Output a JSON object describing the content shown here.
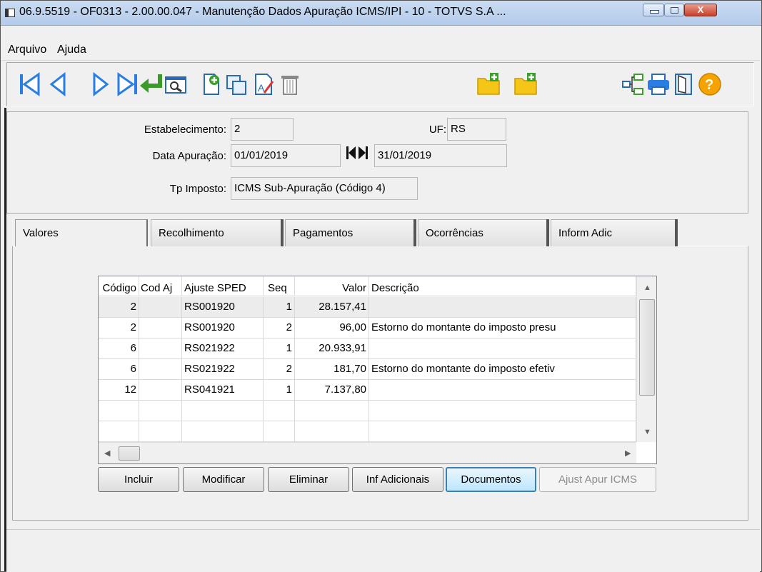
{
  "window": {
    "title": "06.9.5519 - OF0313 - 2.00.00.047 - Manutenção Dados Apuração ICMS/IPI - 10 - TOTVS S.A ...",
    "close_glyph": "X"
  },
  "menu": {
    "items": [
      "Arquivo",
      "Ajuda"
    ]
  },
  "toolbar": {
    "icons": [
      "first-record",
      "previous-record",
      "next-record",
      "last-record",
      "return",
      "search",
      "new-document",
      "copy",
      "edit",
      "delete",
      "folder-add",
      "folder-add-2",
      "tree",
      "print",
      "exit",
      "help"
    ],
    "help_glyph": "?"
  },
  "header": {
    "estabelecimento_label": "Estabelecimento:",
    "estabelecimento_value": "2",
    "uf_label": "UF:",
    "uf_value": "RS",
    "data_label": "Data Apuração:",
    "data_inicio": "01/01/2019",
    "data_fim": "31/01/2019",
    "tp_label": "Tp Imposto:",
    "tp_value": "ICMS Sub-Apuração (Código 4)"
  },
  "tabs": [
    "Valores",
    "Recolhimento",
    "Pagamentos",
    "Ocorrências",
    "Inform Adic"
  ],
  "grid": {
    "columns": [
      "Código",
      "Cod Aj",
      "Ajuste SPED",
      "Seq",
      "Valor",
      "Descrição"
    ],
    "rows": [
      [
        "2",
        "",
        "RS001920",
        "1",
        "28.157,41",
        ""
      ],
      [
        "2",
        "",
        "RS001920",
        "2",
        "96,00",
        "Estorno do montante do imposto presu"
      ],
      [
        "6",
        "",
        "RS021922",
        "1",
        "20.933,91",
        ""
      ],
      [
        "6",
        "",
        "RS021922",
        "2",
        "181,70",
        "Estorno do montante do imposto efetiv"
      ],
      [
        "12",
        "",
        "RS041921",
        "1",
        "7.137,80",
        ""
      ],
      [
        "",
        "",
        "",
        "",
        "",
        ""
      ],
      [
        "",
        "",
        "",
        "",
        "",
        ""
      ]
    ]
  },
  "buttons": {
    "incluir": "Incluir",
    "modificar": "Modificar",
    "eliminar": "Eliminar",
    "inf_adicionais": "Inf Adicionais",
    "documentos": "Documentos",
    "ajust_apur": "Ajust Apur ICMS"
  },
  "colors": {
    "accent": "#3c7fb1",
    "title_bar": "#b4cbea",
    "nav_blue": "#2a7de1",
    "folder_yellow": "#f5c518"
  }
}
